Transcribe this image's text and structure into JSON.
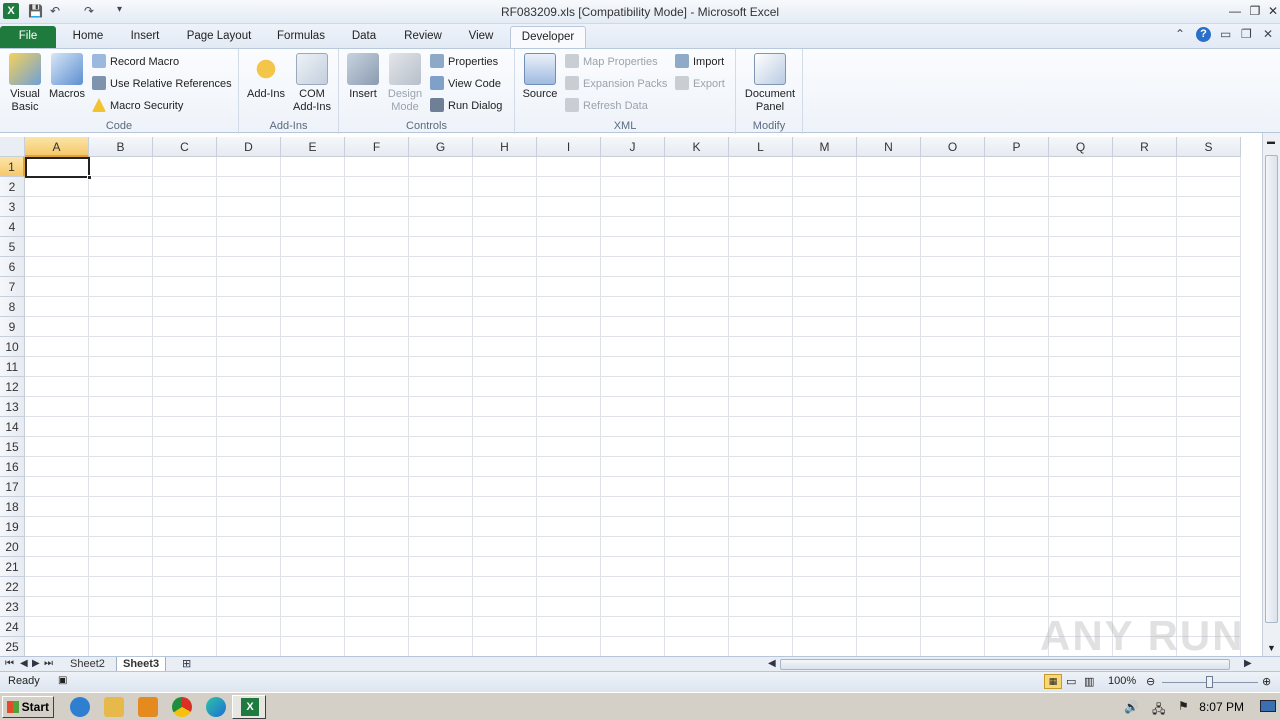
{
  "window": {
    "title": "RF083209.xls  [Compatibility Mode]  -  Microsoft Excel"
  },
  "tabs": [
    "File",
    "Home",
    "Insert",
    "Page Layout",
    "Formulas",
    "Data",
    "Review",
    "View",
    "Developer"
  ],
  "active_tab": "Developer",
  "ribbon": {
    "code": {
      "label": "Code",
      "visual_basic": "Visual Basic",
      "macros": "Macros",
      "record_macro": "Record Macro",
      "use_relative": "Use Relative References",
      "macro_security": "Macro Security"
    },
    "addins": {
      "label": "Add-Ins",
      "addins": "Add-Ins",
      "com_addins": "COM Add-Ins"
    },
    "controls": {
      "label": "Controls",
      "insert": "Insert",
      "design_mode": "Design Mode",
      "properties": "Properties",
      "view_code": "View Code",
      "run_dialog": "Run Dialog"
    },
    "xml": {
      "label": "XML",
      "source": "Source",
      "map_properties": "Map Properties",
      "expansion_packs": "Expansion Packs",
      "refresh_data": "Refresh Data",
      "import": "Import",
      "export": "Export"
    },
    "modify": {
      "label": "Modify",
      "document_panel": "Document Panel"
    }
  },
  "columns": [
    "A",
    "B",
    "C",
    "D",
    "E",
    "F",
    "G",
    "H",
    "I",
    "J",
    "K",
    "L",
    "M",
    "N",
    "O",
    "P",
    "Q",
    "R",
    "S"
  ],
  "rows": [
    "1",
    "2",
    "3",
    "4",
    "5",
    "6",
    "7",
    "8",
    "9",
    "10",
    "11",
    "12",
    "13",
    "14",
    "15",
    "16",
    "17",
    "18",
    "19",
    "20",
    "21",
    "22",
    "23",
    "24",
    "25"
  ],
  "active_cell": "A1",
  "sheets": [
    "Sheet2",
    "Sheet3"
  ],
  "active_sheet": "Sheet3",
  "status": {
    "ready": "Ready",
    "zoom": "100%"
  },
  "taskbar": {
    "start": "Start",
    "clock": "8:07 PM"
  },
  "watermark": "ANY RUN",
  "colors": {
    "file_tab": "#1f7a3d",
    "selection_header": "#f6c96b"
  }
}
